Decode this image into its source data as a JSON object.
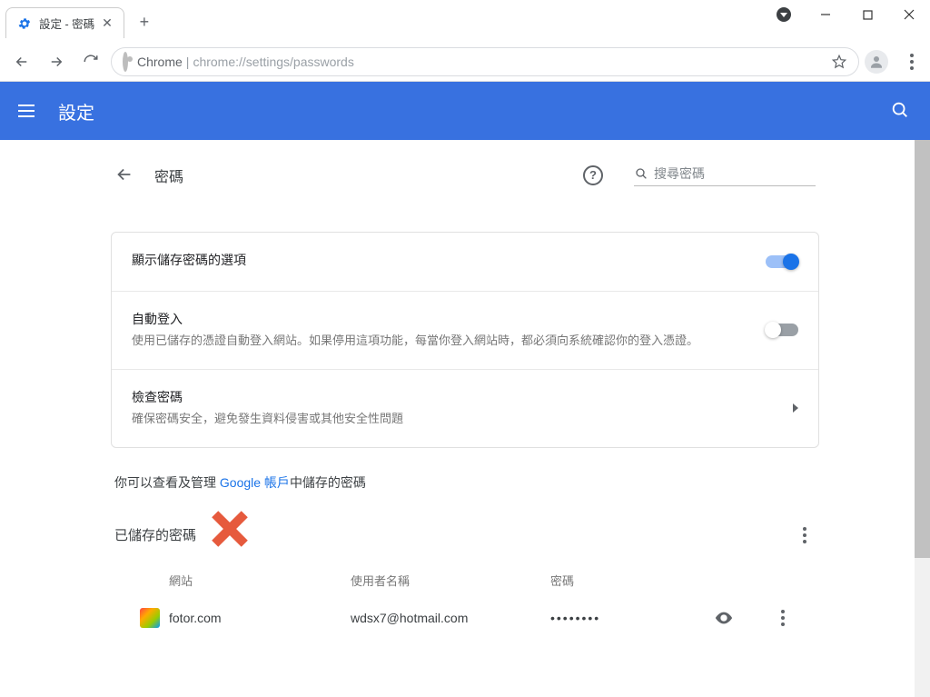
{
  "window": {
    "tab_title": "設定 - 密碼",
    "url_prefix": "Chrome",
    "url_sep": " | ",
    "url": "chrome://settings/passwords"
  },
  "header": {
    "title": "設定"
  },
  "section": {
    "back_label": "back",
    "title": "密碼",
    "search_placeholder": "搜尋密碼"
  },
  "rows": {
    "offer_save": {
      "title": "顯示儲存密碼的選項",
      "on": true
    },
    "auto_signin": {
      "title": "自動登入",
      "desc": "使用已儲存的憑證自動登入網站。如果停用這項功能，每當你登入網站時，都必須向系統確認你的登入憑證。",
      "on": false
    },
    "check_pw": {
      "title": "檢查密碼",
      "desc": "確保密碼安全，避免發生資料侵害或其他安全性問題"
    }
  },
  "info_line": {
    "before": "你可以查看及管理 ",
    "link": "Google 帳戶",
    "after": "中儲存的密碼"
  },
  "saved": {
    "heading": "已儲存的密碼",
    "columns": {
      "site": "網站",
      "user": "使用者名稱",
      "pw": "密碼"
    },
    "entries": [
      {
        "site": "fotor.com",
        "user": "wdsx7@hotmail.com",
        "pw": "••••••••"
      }
    ]
  }
}
